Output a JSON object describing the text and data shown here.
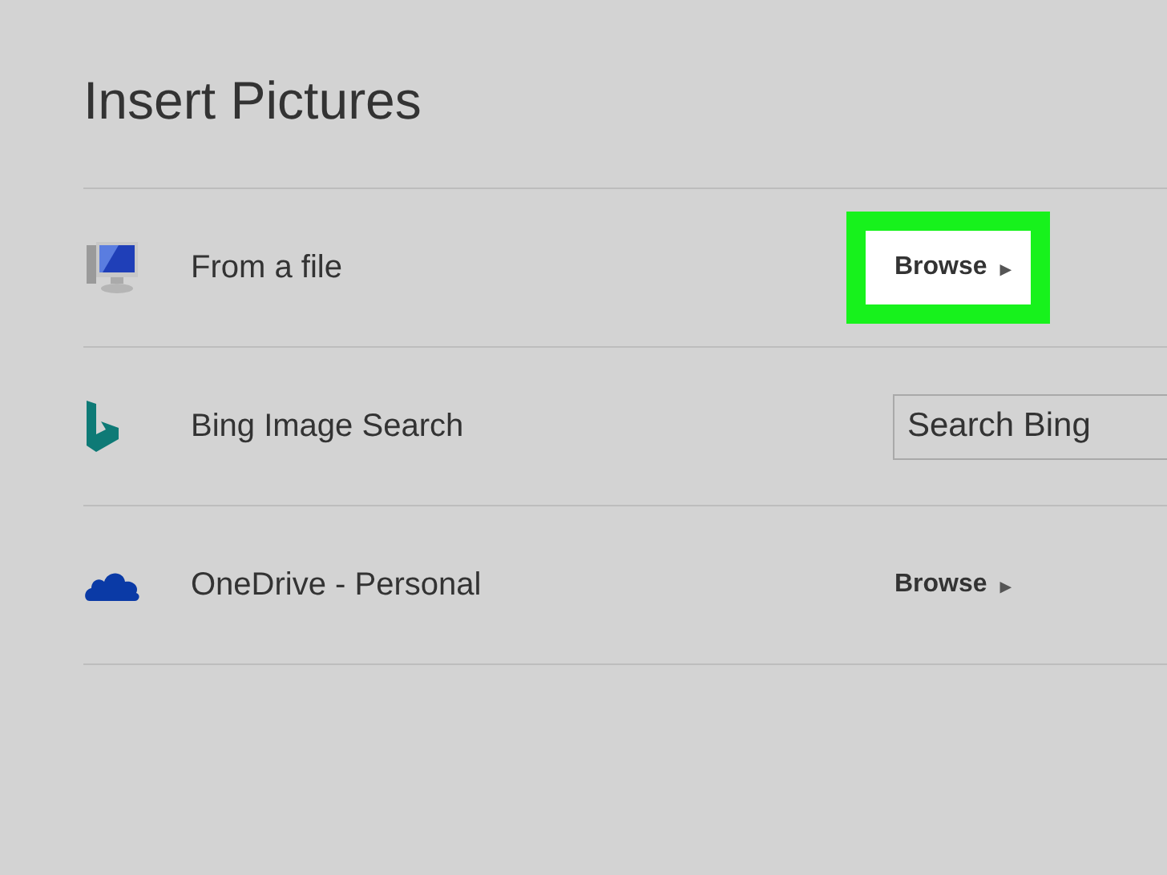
{
  "dialog": {
    "title": "Insert Pictures"
  },
  "sources": [
    {
      "label": "From a file",
      "kind": "browse",
      "action": {
        "label": "Browse",
        "arrow": "▸",
        "highlighted": true
      }
    },
    {
      "label": "Bing Image Search",
      "kind": "search",
      "action": {
        "placeholder": "Search Bing"
      }
    },
    {
      "label": "OneDrive - Personal",
      "kind": "browse",
      "action": {
        "label": "Browse",
        "arrow": "▸",
        "highlighted": false
      }
    }
  ]
}
